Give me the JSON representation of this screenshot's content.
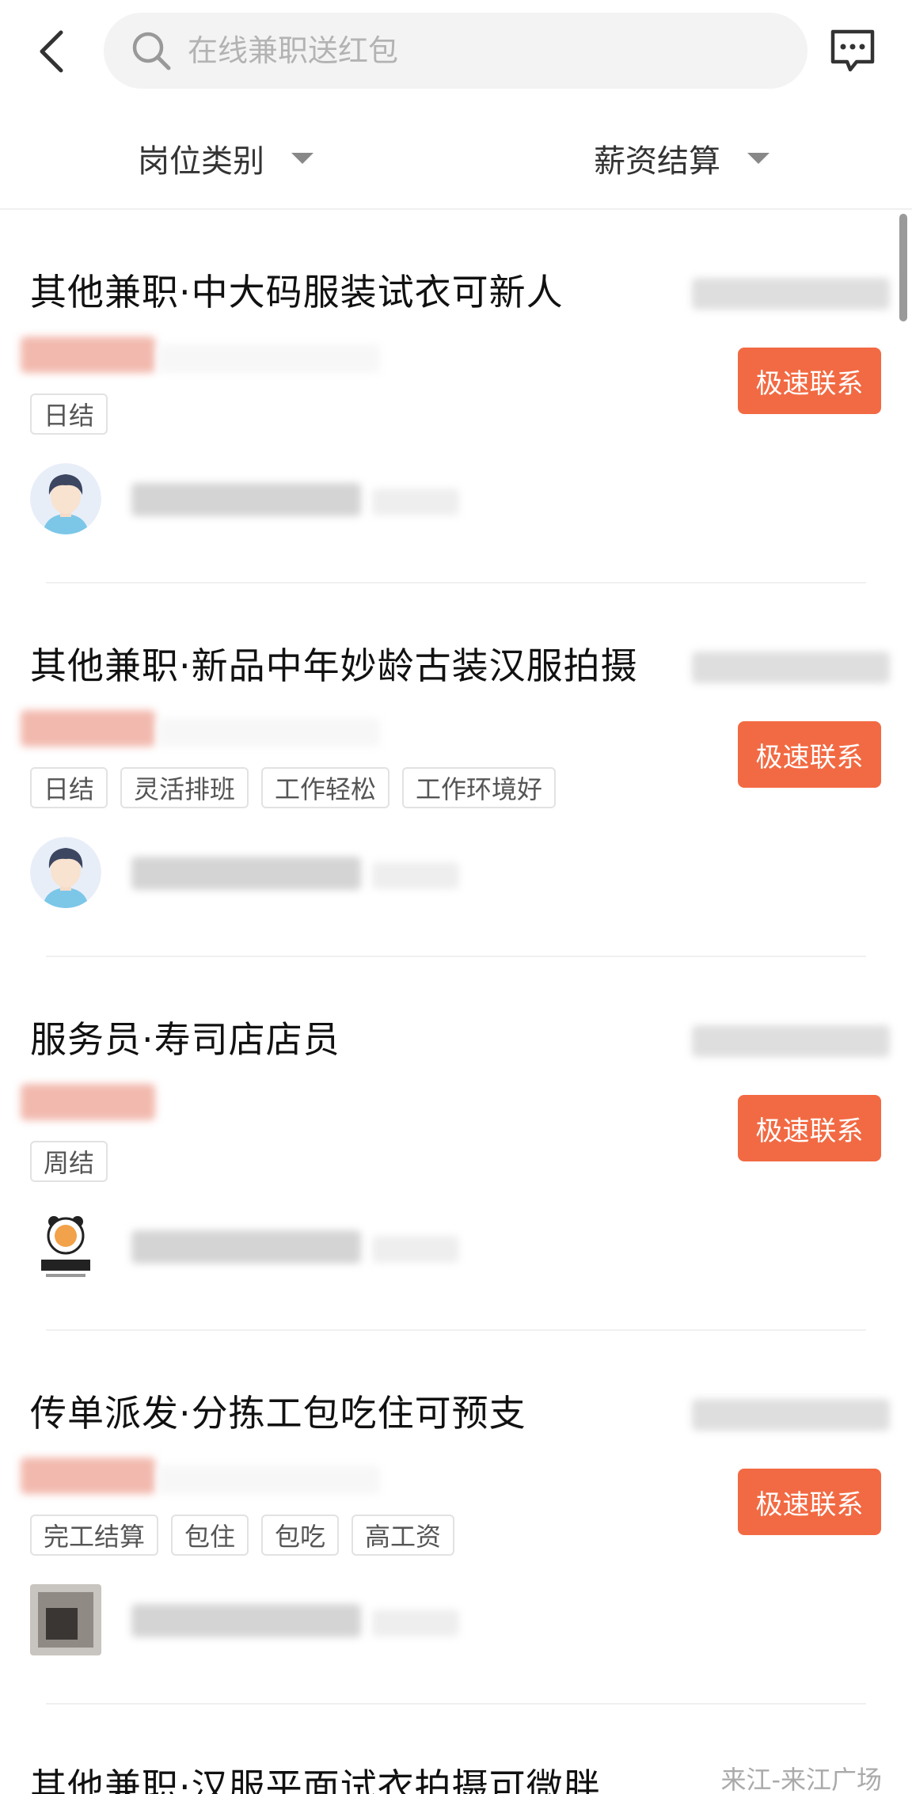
{
  "search": {
    "placeholder": "在线兼职送红包"
  },
  "filters": [
    {
      "label": "岗位类别"
    },
    {
      "label": "薪资结算"
    }
  ],
  "jobs": [
    {
      "title": "其他兼职·中大码服装试衣可新人",
      "tags": [
        "日结"
      ],
      "contact_label": "极速联系"
    },
    {
      "title": "其他兼职·新品中年妙龄古装汉服拍摄",
      "tags": [
        "日结",
        "灵活排班",
        "工作轻松",
        "工作环境好"
      ],
      "contact_label": "极速联系"
    },
    {
      "title": "服务员·寿司店店员",
      "tags": [
        "周结"
      ],
      "contact_label": "极速联系"
    },
    {
      "title": "传单派发·分拣工包吃住可预支",
      "tags": [
        "完工结算",
        "包住",
        "包吃",
        "高工资"
      ],
      "contact_label": "极速联系"
    },
    {
      "title": "其他兼职·汉服平面试衣拍摄可微胖",
      "location": "来江-来江广场"
    }
  ],
  "colors": {
    "accent": "#f26a43",
    "tag_border": "#e2e2e2",
    "search_bg": "#f3f3f3"
  },
  "icons": {
    "back": "chevron-left-icon",
    "search": "search-icon",
    "message": "message-icon",
    "caret": "caret-down-icon"
  }
}
